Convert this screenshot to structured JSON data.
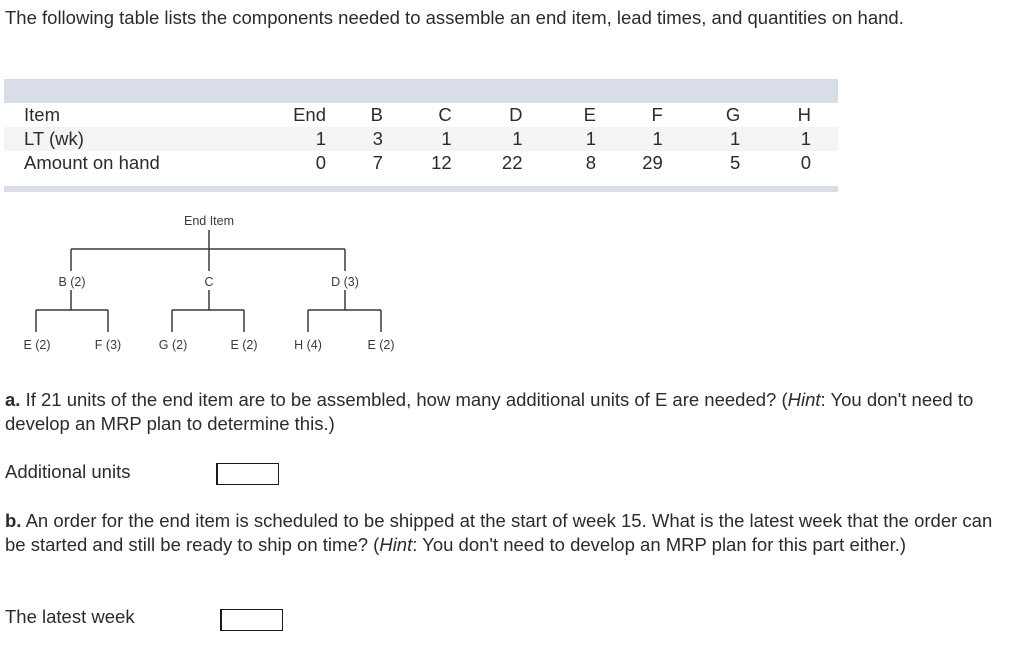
{
  "intro": "The following table lists the components needed to assemble an end item, lead times, and quantities on hand.",
  "table": {
    "rows": [
      {
        "label": "Item",
        "values": [
          "End",
          "B",
          "C",
          "D",
          "E",
          "F",
          "G",
          "H"
        ]
      },
      {
        "label": "LT (wk)",
        "values": [
          "1",
          "3",
          "1",
          "1",
          "1",
          "1",
          "1",
          "1"
        ]
      },
      {
        "label": "Amount on hand",
        "values": [
          "0",
          "7",
          "12",
          "22",
          "8",
          "29",
          "5",
          "0"
        ]
      }
    ]
  },
  "tree": {
    "root": "End Item",
    "level1": [
      "B (2)",
      "C",
      "D (3)"
    ],
    "level2": [
      "E (2)",
      "F (3)",
      "G (2)",
      "E (2)",
      "H (4)",
      "E (2)"
    ]
  },
  "question_a": {
    "prefix": "a.",
    "text": " If 21 units of the end item are to be assembled, how many additional units of E are needed? (",
    "hint_label": "Hint",
    "hint_text": ": You don't need to develop an MRP plan to determine this.)",
    "answer_label": "Additional units",
    "answer_value": ""
  },
  "question_b": {
    "prefix": "b.",
    "text": " An order for the end item is scheduled to be shipped at the start of week 15. What is the latest week that the order can be started and still be ready to ship on time? (",
    "hint_label": "Hint",
    "hint_text": ": You don't need to develop an MRP plan for this part either.)",
    "answer_label": "The latest week",
    "answer_value": ""
  }
}
